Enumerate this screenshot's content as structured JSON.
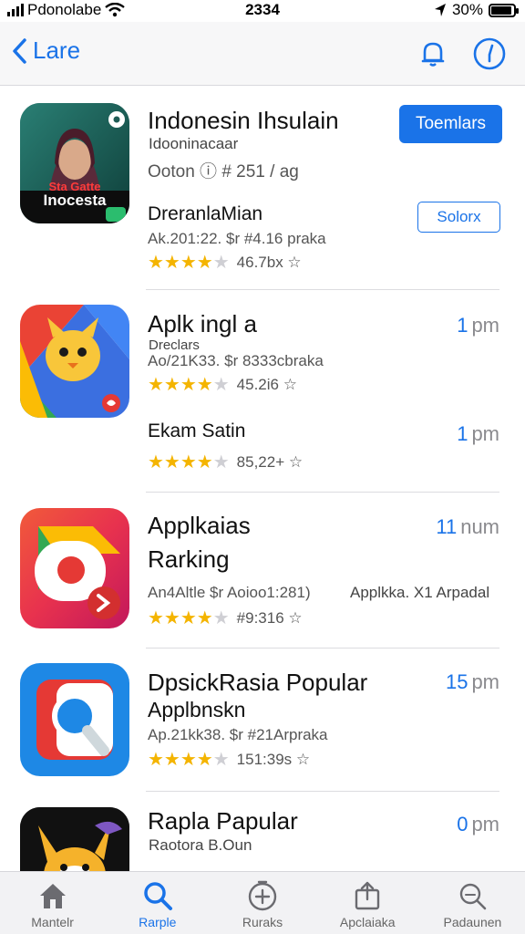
{
  "status_bar": {
    "carrier": "Pdonolabe",
    "time": "2334",
    "battery": "30%"
  },
  "nav": {
    "back_label": "Lare"
  },
  "featured": {
    "title": "Indonesin Ihsulain",
    "subtitle": "Idooninacaar",
    "meta": "Ooton  ⓘ # 251 / ag",
    "button_label": "Toemlars",
    "banner_lines": [
      "Sta Gatte",
      "Inocesta"
    ],
    "sub_item": {
      "title": "DreranlaMian",
      "meta": "Ak.201:22. $r #4.16 praka",
      "rating_text": "46.7bx ☆",
      "button_label": "Solorx"
    }
  },
  "apps": [
    {
      "title": "Aplk ingl a",
      "subtitle": "Dreclars",
      "meta": "Ao/21K33. $r 8333cbraka",
      "rating_text": "45.2i6 ☆",
      "time": "1",
      "unit": "pm",
      "stars": 4
    },
    {
      "title": "Ekam Satin",
      "rating_text": "85,22+ ☆",
      "time": "1",
      "unit": "pm",
      "stars": 4
    },
    {
      "title": "Applkaias",
      "title2": "Rarking",
      "meta": "An4Altle $r Aoioo1:281)",
      "meta_right": "Applkka. X1 Arpadal",
      "rating_text": "#9:316 ☆",
      "time": "11",
      "unit": "num",
      "stars": 4
    },
    {
      "title": "DpsickRasia Popular",
      "title2": "Applbnskn",
      "meta": "Ap.21kk38. $r #21Arpraka",
      "rating_text": "151:39s ☆",
      "time": "15",
      "unit": "pm",
      "stars": 4
    },
    {
      "title": "Rapla Papular",
      "subtitle": "Raotora B.Oun",
      "time": "0",
      "unit": "pm"
    }
  ],
  "tabs": [
    {
      "label": "Mantelr",
      "icon": "home-icon"
    },
    {
      "label": "Rarple",
      "icon": "search-icon",
      "active": true
    },
    {
      "label": "Ruraks",
      "icon": "add-circle-icon"
    },
    {
      "label": "Apclaiaka",
      "icon": "share-icon"
    },
    {
      "label": "Padaunen",
      "icon": "search-outline-icon"
    }
  ],
  "colors": {
    "accent": "#1a73e8",
    "star": "#f4b400"
  }
}
